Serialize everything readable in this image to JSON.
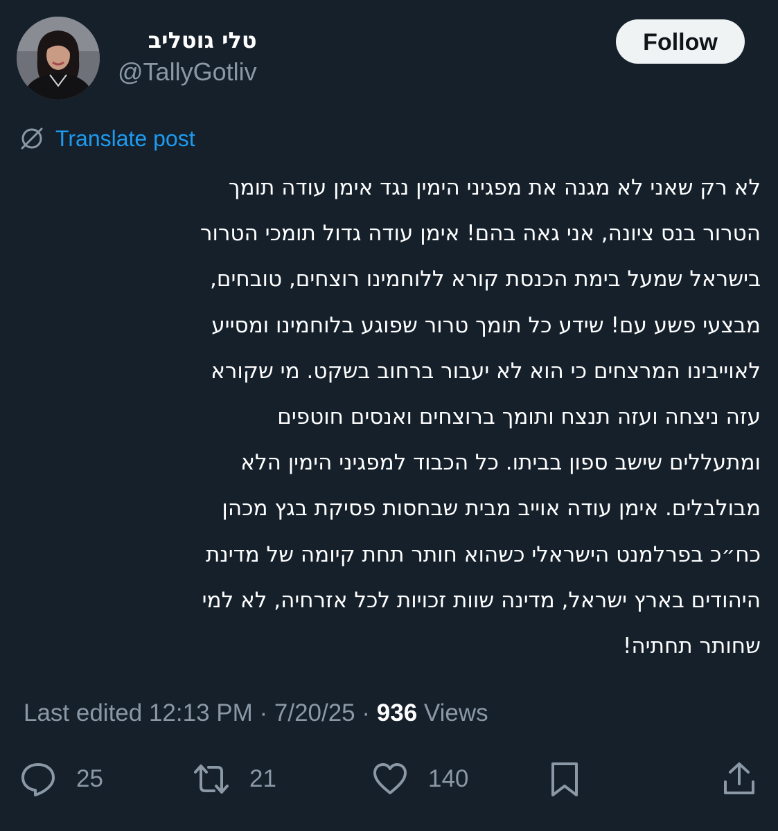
{
  "author": {
    "display_name": "טלי גוטליב",
    "handle": "@TallyGotliv",
    "avatar_icon": "profile-photo"
  },
  "follow_button": {
    "label": "Follow"
  },
  "translate": {
    "label": "Translate post",
    "icon": "globe-slash-icon"
  },
  "post": {
    "lines": [
      "לא רק שאני לא מגנה את מפגיני הימין נגד אימן עודה תומך",
      "הטרור בנס ציונה, אני גאה בהם! אימן עודה גדול תומכי הטרור",
      "בישראל שמעל בימת  הכנסת קורא ללוחמינו רוצחים, טובחים,",
      "מבצעי פשע עם! שידע כל תומך טרור שפוגע בלוחמינו ומסייע",
      "לאוייבינו המרצחים כי הוא לא יעבור ברחוב בשקט. מי שקורא",
      "עזה ניצחה ועזה תנצח ותומך ברוצחים ואנסים חוטפים",
      "ומתעללים שישב ספון בביתו. כל הכבוד למפגיני הימין הלא",
      "מבולבלים. אימן עודה אוייב מבית שבחסות פסיקת בגץ מכהן",
      "כח״כ בפרלמנט הישראלי כשהוא חותר תחת קיומה של מדינת",
      "היהודים בארץ ישראל, מדינה שוות זכויות לכל אזרחיה, לא למי",
      "שחותר תחתיה!"
    ]
  },
  "meta": {
    "edited_label": "Last edited 12:13 PM · 7/20/25",
    "separator": " · ",
    "views_count": "936",
    "views_label": " Views"
  },
  "actions": {
    "reply": {
      "icon": "reply-icon",
      "count": "25"
    },
    "repost": {
      "icon": "repost-icon",
      "count": "21"
    },
    "like": {
      "icon": "heart-icon",
      "count": "140"
    },
    "bookmark": {
      "icon": "bookmark-icon"
    },
    "share": {
      "icon": "share-icon"
    }
  },
  "colors": {
    "background": "#15202b",
    "text_primary": "#ffffff",
    "text_secondary": "#8b98a5",
    "accent_link": "#1d9bf0",
    "button_bg": "#eff3f4"
  }
}
